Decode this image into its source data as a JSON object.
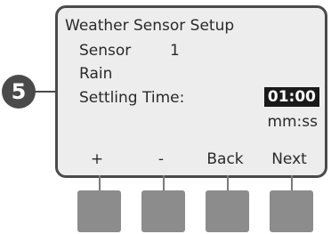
{
  "step": {
    "number": "5"
  },
  "screen": {
    "title": "Weather Sensor Setup",
    "sensor_label": "Sensor",
    "sensor_number": "1",
    "sensor_type": "Rain",
    "settling_label": "Settling Time:",
    "settling_value": "01:00",
    "settling_units": "mm:ss"
  },
  "softkeys": {
    "plus": "+",
    "minus": "-",
    "back": "Back",
    "next": "Next"
  }
}
